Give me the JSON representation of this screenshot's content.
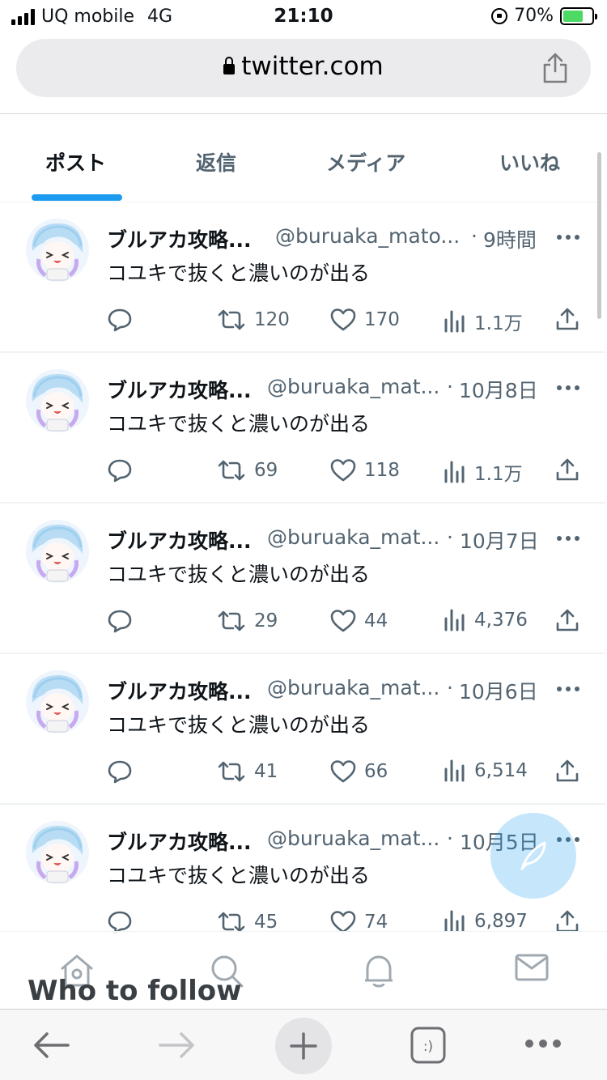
{
  "status_bar": {
    "carrier": "UQ mobile",
    "network": "4G",
    "time": "21:10",
    "battery": "70%",
    "battery_level": 0.7
  },
  "browser": {
    "url": "twitter.com"
  },
  "tabs": [
    {
      "label": "ポスト",
      "active": true
    },
    {
      "label": "返信",
      "active": false
    },
    {
      "label": "メディア",
      "active": false
    },
    {
      "label": "いいね",
      "active": false
    }
  ],
  "posts": [
    {
      "name": "ブルアカ攻略...",
      "handle": "@buruaka_mato...",
      "time": "9時間",
      "text": "コユキで抜くと濃いのが出る",
      "retweets": "120",
      "likes": "170",
      "views": "1.1万"
    },
    {
      "name": "ブルアカ攻略...",
      "handle": "@buruaka_mat...",
      "time": "10月8日",
      "text": "コユキで抜くと濃いのが出る",
      "retweets": "69",
      "likes": "118",
      "views": "1.1万"
    },
    {
      "name": "ブルアカ攻略...",
      "handle": "@buruaka_mat...",
      "time": "10月7日",
      "text": "コユキで抜くと濃いのが出る",
      "retweets": "29",
      "likes": "44",
      "views": "4,376"
    },
    {
      "name": "ブルアカ攻略...",
      "handle": "@buruaka_mat...",
      "time": "10月6日",
      "text": "コユキで抜くと濃いのが出る",
      "retweets": "41",
      "likes": "66",
      "views": "6,514"
    },
    {
      "name": "ブルアカ攻略...",
      "handle": "@buruaka_mat...",
      "time": "10月5日",
      "text": "コユキで抜くと濃いのが出る",
      "retweets": "45",
      "likes": "74",
      "views": "6,897"
    }
  ],
  "overlay": {
    "who_to_follow": "Who to follow"
  },
  "twitter_nav": [
    "home-icon",
    "search-icon",
    "bell-icon",
    "mail-icon"
  ],
  "safari_toolbar": [
    "back-arrow-icon",
    "forward-arrow-icon",
    "new-tab-plus-icon",
    "tabs-icon",
    "more-icon"
  ],
  "colors": {
    "accent": "#1d9bf0",
    "text": "#0f1419",
    "muted": "#536471"
  }
}
